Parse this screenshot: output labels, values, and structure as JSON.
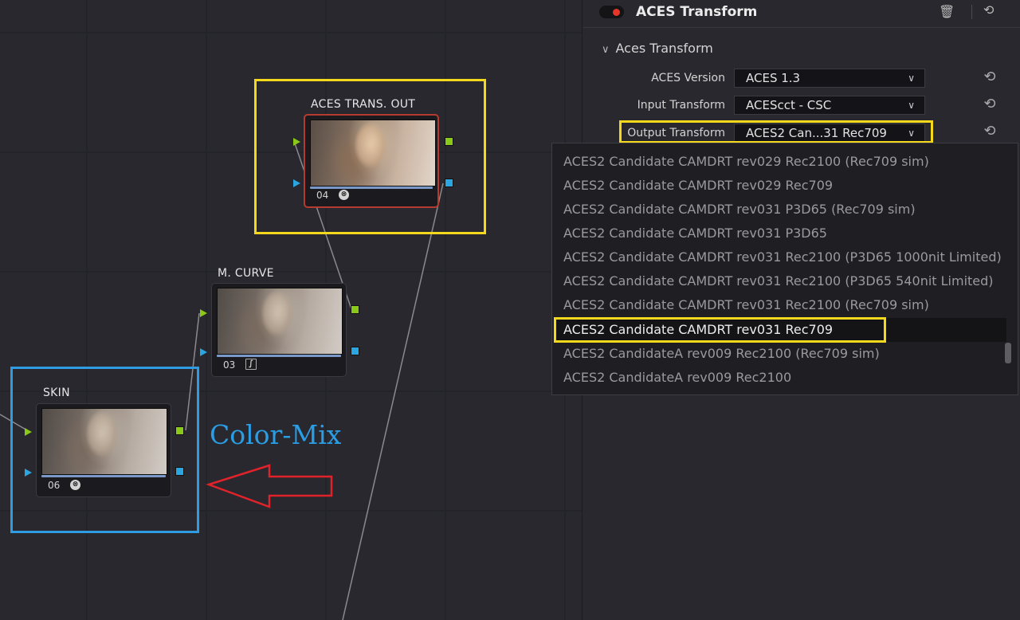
{
  "nodes": {
    "aces_out": {
      "title": "ACES TRANS.  OUT",
      "number": "04"
    },
    "m_curve": {
      "title": "M. CURVE",
      "number": "03"
    },
    "skin": {
      "title": "SKIN",
      "number": "06"
    }
  },
  "annotation": {
    "label": "Color-Mix"
  },
  "inspector": {
    "title": "ACES Transform",
    "section": "Aces Transform",
    "params": [
      {
        "label": "ACES Version",
        "value": "ACES 1.3"
      },
      {
        "label": "Input Transform",
        "value": "ACEScct - CSC"
      },
      {
        "label": "Output Transform",
        "value": "ACES2 Can...31 Rec709"
      }
    ]
  },
  "dropdown": {
    "options": [
      "ACES2 Candidate CAMDRT rev029 Rec2100 (Rec709 sim)",
      "ACES2 Candidate CAMDRT rev029 Rec709",
      "ACES2 Candidate CAMDRT rev031 P3D65 (Rec709 sim)",
      "ACES2 Candidate CAMDRT rev031 P3D65",
      "ACES2 Candidate CAMDRT rev031 Rec2100 (P3D65 1000nit Limited)",
      "ACES2 Candidate CAMDRT rev031 Rec2100 (P3D65 540nit Limited)",
      "ACES2 Candidate CAMDRT rev031 Rec2100 (Rec709 sim)",
      "ACES2 Candidate CAMDRT rev031 Rec709",
      "ACES2 CandidateA rev009 Rec2100 (Rec709 sim)",
      "ACES2 CandidateA rev009 Rec2100"
    ],
    "selected_index": 7
  },
  "colors": {
    "highlight_yellow": "#f3d81c",
    "highlight_blue": "#2e9be2",
    "arrow_red": "#e0232b",
    "port_green": "#8ac91a",
    "port_blue": "#2ba6e0",
    "selected_node_border": "#b53a30"
  }
}
